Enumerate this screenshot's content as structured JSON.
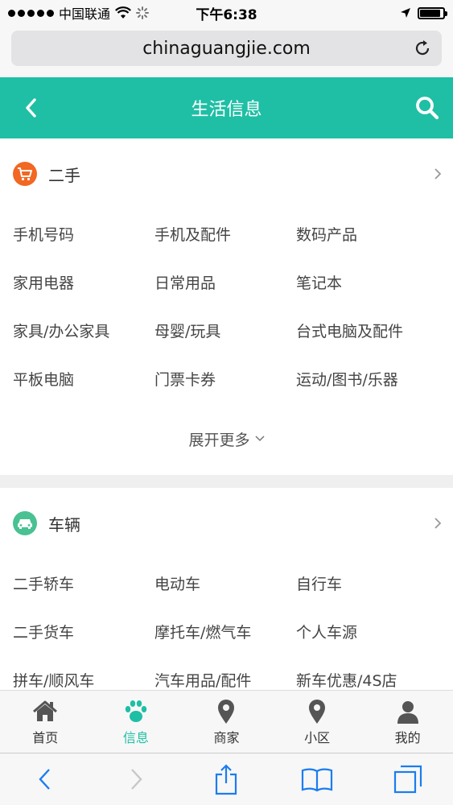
{
  "status_bar": {
    "carrier": "中国联通",
    "time": "下午6:38",
    "battery_level": 0.9
  },
  "address_bar": {
    "url": "chinaguangjie.com"
  },
  "header": {
    "title": "生活信息"
  },
  "sections": [
    {
      "title": "二手",
      "icon": "shopping-cart-icon",
      "icon_color": "#f26722",
      "items": [
        "手机号码",
        "手机及配件",
        "数码产品",
        "家用电器",
        "日常用品",
        "笔记本",
        "家具/办公家具",
        "母婴/玩具",
        "台式电脑及配件",
        "平板电脑",
        "门票卡券",
        "运动/图书/乐器"
      ],
      "more_label": "展开更多"
    },
    {
      "title": "车辆",
      "icon": "car-icon",
      "icon_color": "#49c193",
      "items": [
        "二手轿车",
        "电动车",
        "自行车",
        "二手货车",
        "摩托车/燃气车",
        "个人车源",
        "拼车/顺风车",
        "汽车用品/配件",
        "新车优惠/4S店"
      ]
    }
  ],
  "tabbar": {
    "tabs": [
      {
        "label": "首页",
        "icon": "home-icon"
      },
      {
        "label": "信息",
        "icon": "paw-icon",
        "active": true
      },
      {
        "label": "商家",
        "icon": "location-pin-icon"
      },
      {
        "label": "小区",
        "icon": "location-pin-icon"
      },
      {
        "label": "我的",
        "icon": "user-icon"
      }
    ],
    "active_color": "#1fbfa5",
    "inactive_color": "#555555"
  },
  "colors": {
    "accent": "#1fbfa5"
  }
}
